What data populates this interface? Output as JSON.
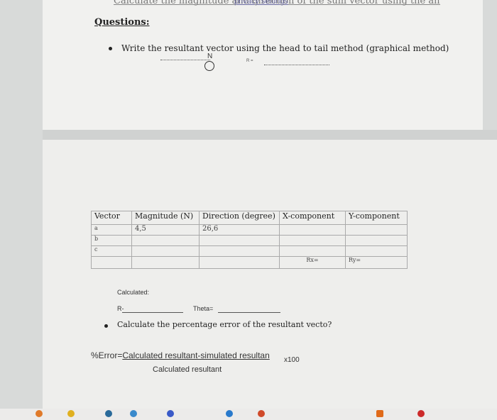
{
  "header": {
    "partial_line": "Calculate the magnitude and direction of the sum vector using the analytical method",
    "privacy_link": "privacy settings"
  },
  "questions": {
    "heading": "Questions:",
    "q1": "Write the resultant vector using the head to tail method (graphical method)",
    "compass_n": "N",
    "r_eq": "R ="
  },
  "table": {
    "headers": [
      "Vector",
      "Magnitude (N)",
      "Direction (degree)",
      "X-component",
      "Y-component"
    ],
    "rows": [
      [
        "a",
        "4,5",
        "26,6",
        "",
        ""
      ],
      [
        "b",
        "",
        "",
        "",
        ""
      ],
      [
        "c",
        "",
        "",
        "",
        ""
      ],
      [
        "",
        "",
        "",
        "Rx=",
        "Ry="
      ]
    ]
  },
  "calculated": {
    "label": "Calculated:",
    "r": "R-",
    "theta": "Theta="
  },
  "q2": "Calculate the percentage error of the resultant vecto?",
  "error_formula": {
    "prefix": "%Error=",
    "numerator": "Calculated resultant-simulated resultan",
    "times": "x100",
    "denominator": "Calculated resultant"
  }
}
